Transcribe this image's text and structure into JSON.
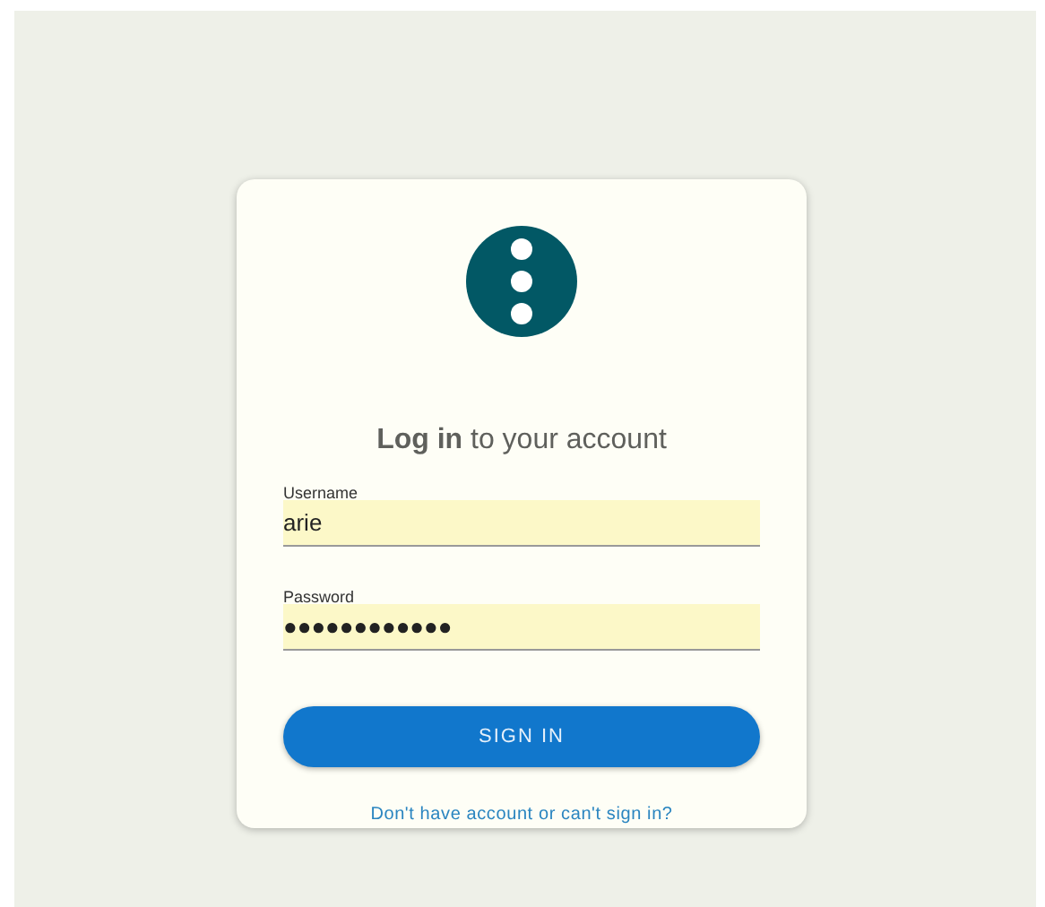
{
  "title": "**Log in** to your account",
  "fields": [
    {
      "label": "Username",
      "value": "arie"
    },
    {
      "label": "Password",
      "value": "●●●●●●●●●●●●"
    }
  ],
  "button": "SIGN IN",
  "link": "Don't have account or can't sign in?"
}
